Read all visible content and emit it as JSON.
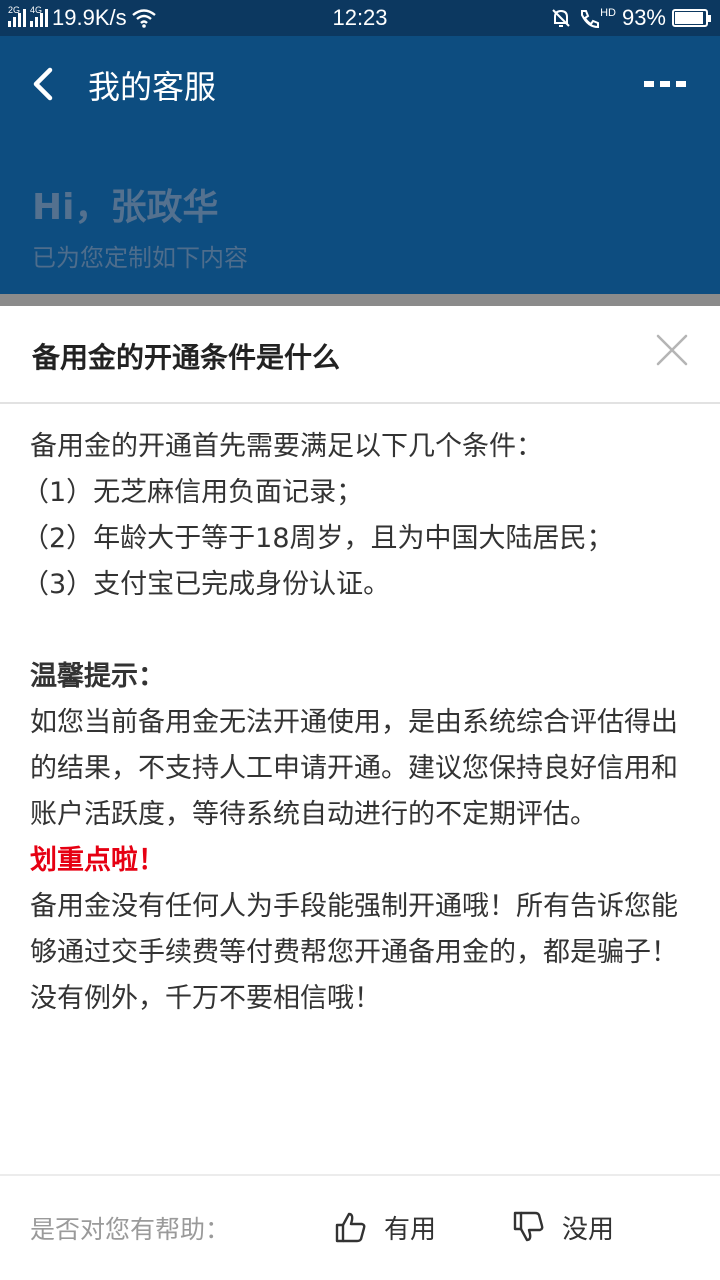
{
  "status_bar": {
    "net_speed": "19.9K/s",
    "time": "12:23",
    "hd_label": "HD",
    "battery_percent": "93%",
    "battery_level": 0.93,
    "signal_tags": [
      "2G",
      "4G"
    ]
  },
  "header": {
    "title": "我的客服",
    "greeting": "Hi，张政华",
    "subtitle": "已为您定制如下内容"
  },
  "sheet": {
    "title": "备用金的开通条件是什么",
    "lines": [
      "备用金的开通首先需要满足以下几个条件：",
      "（1）无芝麻信用负面记录；",
      "（2）年龄大于等于18周岁，且为中国大陆居民；",
      "（3）支付宝已完成身份认证。"
    ],
    "tip_heading": "温馨提示：",
    "tip_body": "如您当前备用金无法开通使用，是由系统综合评估得出的结果，不支持人工申请开通。建议您保持良好信用和账户活跃度，等待系统自动进行的不定期评估。",
    "highlight": "划重点啦！",
    "warning_body": "备用金没有任何人为手段能强制开通哦！所有告诉您能够通过交手续费等付费帮您开通备用金的，都是骗子！没有例外，千万不要相信哦！"
  },
  "footer": {
    "question": "是否对您有帮助：",
    "useful_label": "有用",
    "useless_label": "没用"
  },
  "colors": {
    "header_bg": "#0d4d80",
    "status_bg": "#0c3860",
    "highlight_red": "#e60012"
  }
}
